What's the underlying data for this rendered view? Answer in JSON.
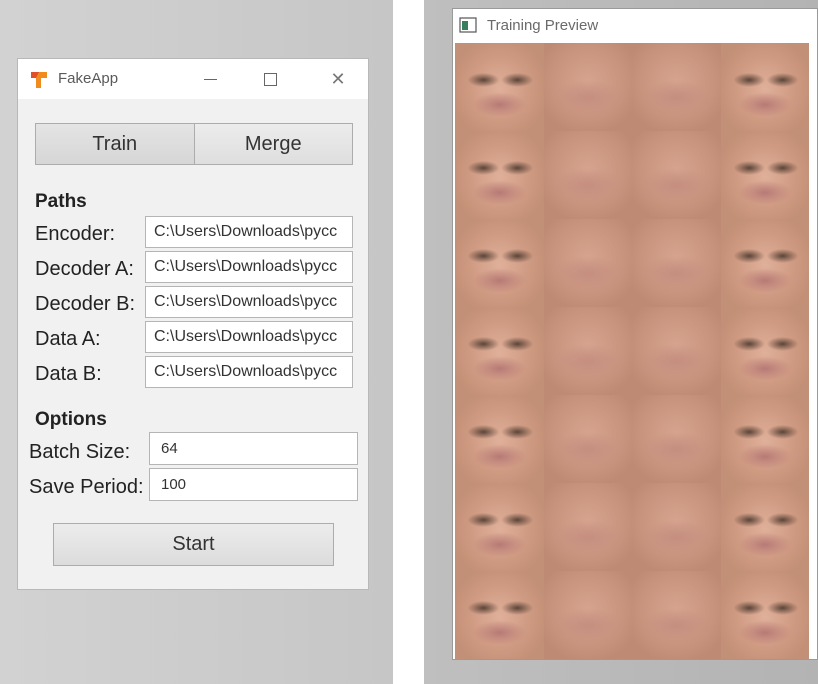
{
  "fakeapp": {
    "title": "FakeApp",
    "tabs": [
      {
        "label": "Train"
      },
      {
        "label": "Merge"
      }
    ],
    "paths": {
      "heading": "Paths",
      "fields": [
        {
          "label": "Encoder:",
          "value": "C:\\Users\\Downloads\\pycc"
        },
        {
          "label": "Decoder A:",
          "value": "C:\\Users\\Downloads\\pycc"
        },
        {
          "label": "Decoder B:",
          "value": "C:\\Users\\Downloads\\pycc"
        },
        {
          "label": "Data A:",
          "value": "C:\\Users\\Downloads\\pycc"
        },
        {
          "label": "Data B:",
          "value": "C:\\Users\\Downloads\\pycc"
        }
      ]
    },
    "options": {
      "heading": "Options",
      "batch_size_label": "Batch Size:",
      "batch_size_value": "64",
      "save_period_label": "Save Period:",
      "save_period_value": "100"
    },
    "start_label": "Start",
    "logo_colors": {
      "orange": "#f08c1e",
      "red": "#e0502a"
    }
  },
  "preview": {
    "title": "Training Preview",
    "grid": {
      "rows": 7,
      "columns": 4,
      "column_kinds": [
        "face",
        "blur",
        "blur",
        "face"
      ]
    }
  }
}
